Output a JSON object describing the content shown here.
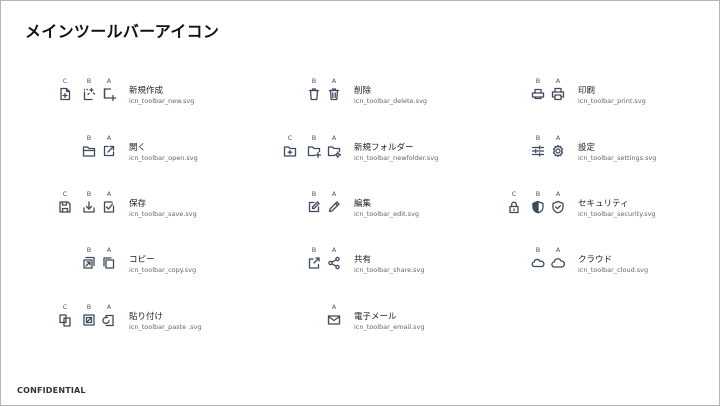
{
  "title": "メインツールバーアイコン",
  "footer": "CONFIDENTIAL",
  "columns": [
    {
      "entries": [
        {
          "name": "新規作成",
          "file": "icn_toolbar_new.svg",
          "variants": [
            {
              "letter": "C",
              "icon": "new-file-plus-icon"
            },
            {
              "letter": "B",
              "icon": "new-sparkle-icon"
            },
            {
              "letter": "A",
              "icon": "new-square-plus-icon"
            }
          ]
        },
        {
          "name": "開く",
          "file": "icn_toolbar_open.svg",
          "variants": [
            {
              "letter": "B",
              "icon": "open-folder-icon"
            },
            {
              "letter": "A",
              "icon": "open-external-icon"
            }
          ]
        },
        {
          "name": "保存",
          "file": "icn_toolbar_save.svg",
          "variants": [
            {
              "letter": "C",
              "icon": "save-floppy-icon"
            },
            {
              "letter": "B",
              "icon": "save-download-icon"
            },
            {
              "letter": "A",
              "icon": "save-check-icon"
            }
          ]
        },
        {
          "name": "コピー",
          "file": "icn_toolbar_copy.svg",
          "variants": [
            {
              "letter": "B",
              "icon": "copy-arrow-icon"
            },
            {
              "letter": "A",
              "icon": "copy-pages-icon"
            }
          ]
        },
        {
          "name": "貼り付け",
          "file": "icn_toolbar_paste .svg",
          "variants": [
            {
              "letter": "C",
              "icon": "paste-pages-icon"
            },
            {
              "letter": "B",
              "icon": "paste-arrow-icon"
            },
            {
              "letter": "A",
              "icon": "paste-rotate-icon"
            }
          ]
        }
      ]
    },
    {
      "entries": [
        {
          "name": "削除",
          "file": "icn_toolbar_delete.svg",
          "variants": [
            {
              "letter": "B",
              "icon": "trash-icon"
            },
            {
              "letter": "A",
              "icon": "trash-lines-icon"
            }
          ]
        },
        {
          "name": "新規フォルダー",
          "file": "icn_toolbar_newfolder.svg",
          "variants": [
            {
              "letter": "C",
              "icon": "folder-plus-box-icon"
            },
            {
              "letter": "B",
              "icon": "folder-plus-icon"
            },
            {
              "letter": "A",
              "icon": "folder-sparkle-icon"
            }
          ]
        },
        {
          "name": "編集",
          "file": "icn_toolbar_edit.svg",
          "variants": [
            {
              "letter": "B",
              "icon": "edit-square-icon"
            },
            {
              "letter": "A",
              "icon": "pencil-icon"
            }
          ]
        },
        {
          "name": "共有",
          "file": "icn_toolbar_share.svg",
          "variants": [
            {
              "letter": "B",
              "icon": "share-box-icon"
            },
            {
              "letter": "A",
              "icon": "share-nodes-icon"
            }
          ]
        },
        {
          "name": "電子メール",
          "file": "icn_toolbar_email.svg",
          "variants": [
            {
              "letter": "A",
              "icon": "mail-icon"
            }
          ]
        }
      ]
    },
    {
      "entries": [
        {
          "name": "印刷",
          "file": "icn_toolbar_print.svg",
          "variants": [
            {
              "letter": "B",
              "icon": "printer-flat-icon"
            },
            {
              "letter": "A",
              "icon": "printer-icon"
            }
          ]
        },
        {
          "name": "設定",
          "file": "icn_toolbar_settings.svg",
          "variants": [
            {
              "letter": "B",
              "icon": "sliders-icon"
            },
            {
              "letter": "A",
              "icon": "gear-icon"
            }
          ]
        },
        {
          "name": "セキュリティ",
          "file": "icn_toolbar_security.svg",
          "variants": [
            {
              "letter": "C",
              "icon": "lock-icon"
            },
            {
              "letter": "B",
              "icon": "shield-half-icon"
            },
            {
              "letter": "A",
              "icon": "shield-check-icon"
            }
          ]
        },
        {
          "name": "クラウド",
          "file": "icn_toolbar_cloud.svg",
          "variants": [
            {
              "letter": "B",
              "icon": "cloud-small-icon"
            },
            {
              "letter": "A",
              "icon": "cloud-icon"
            }
          ]
        }
      ]
    }
  ]
}
